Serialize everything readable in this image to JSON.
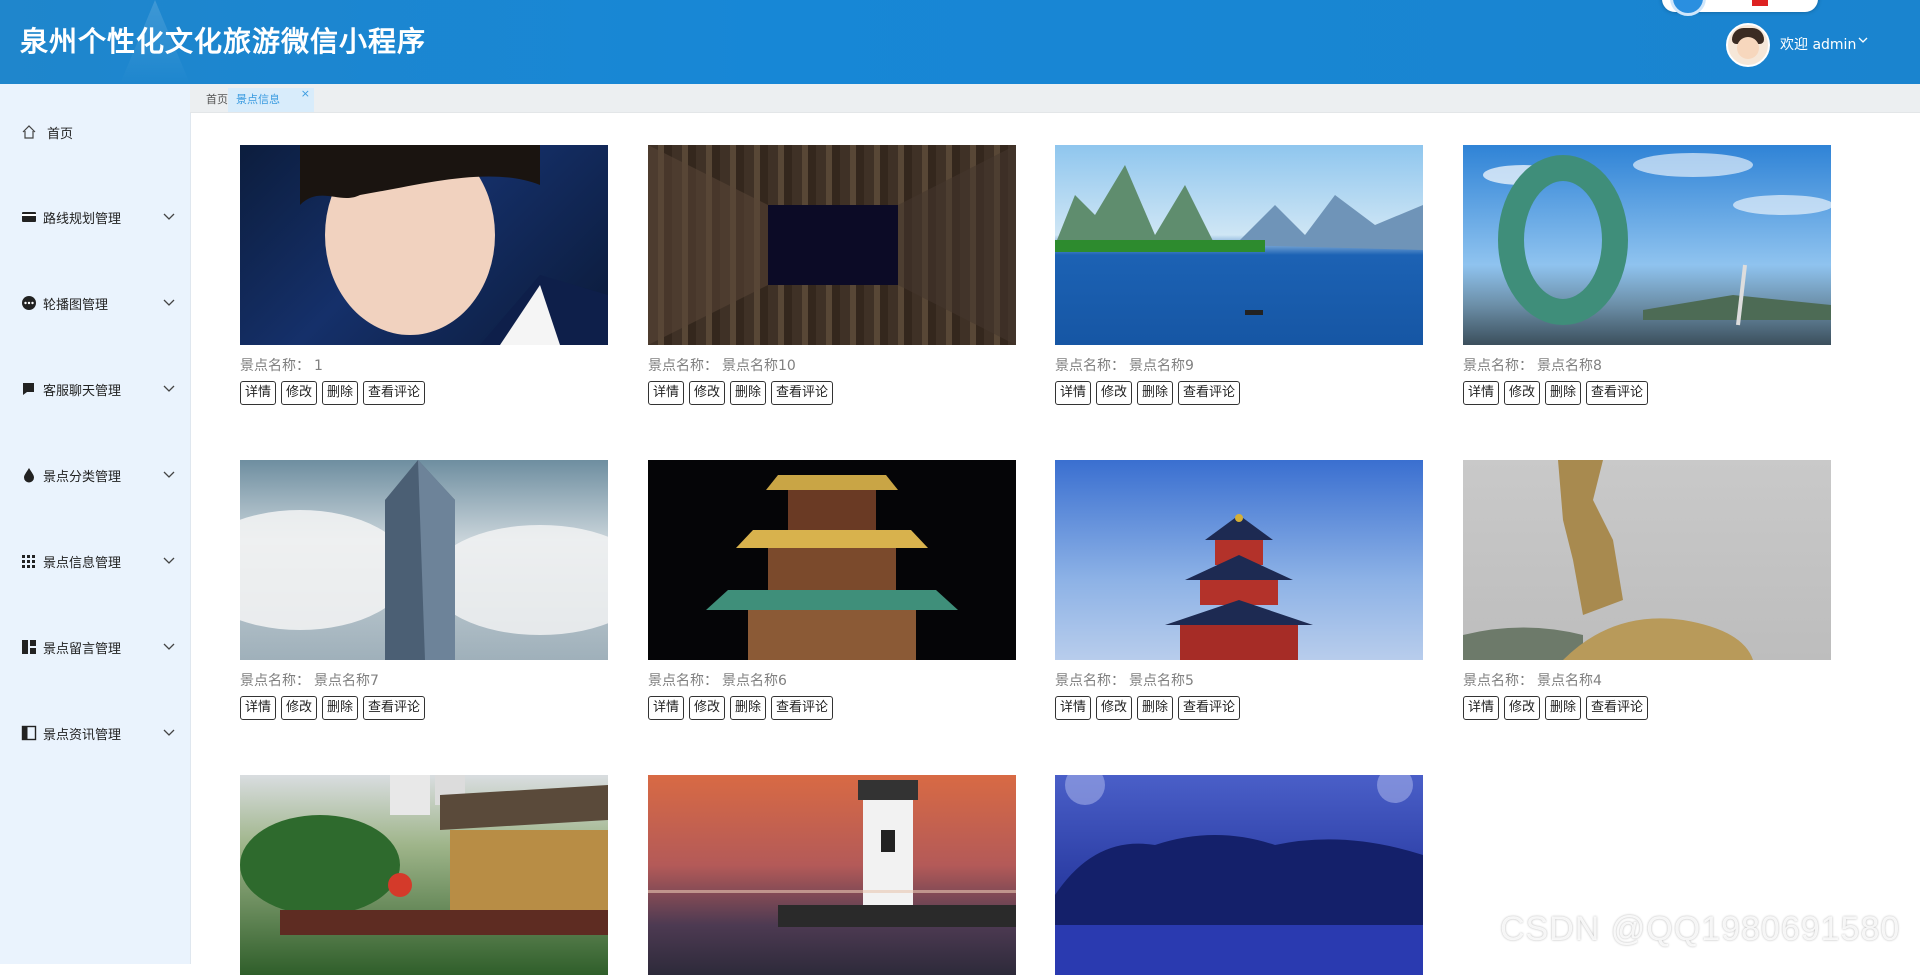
{
  "app": {
    "title": "泉州个性化文化旅游微信小程序"
  },
  "user": {
    "welcome": "欢迎 admin"
  },
  "tabs": [
    {
      "label": "首页"
    },
    {
      "label": "景点信息"
    }
  ],
  "sidebar": {
    "items": [
      {
        "label": "首页",
        "icon": "home-icon"
      },
      {
        "label": "路线规划管理",
        "icon": "card-icon"
      },
      {
        "label": "轮播图管理",
        "icon": "more-circle-icon"
      },
      {
        "label": "客服聊天管理",
        "icon": "chat-icon"
      },
      {
        "label": "景点分类管理",
        "icon": "drop-icon"
      },
      {
        "label": "景点信息管理",
        "icon": "grid-icon"
      },
      {
        "label": "景点留言管理",
        "icon": "layout-icon"
      },
      {
        "label": "景点资讯管理",
        "icon": "panel-icon"
      }
    ]
  },
  "card_prefix": "景点名称：",
  "buttons": {
    "detail": "详情",
    "edit": "修改",
    "delete": "删除",
    "comments": "查看评论"
  },
  "cards": [
    {
      "name": "1",
      "image": "portrait"
    },
    {
      "name": "景点名称10",
      "image": "buildings"
    },
    {
      "name": "景点名称9",
      "image": "karst-river"
    },
    {
      "name": "景点名称8",
      "image": "ring-sculpture"
    },
    {
      "name": "景点名称7",
      "image": "skyscraper-clouds"
    },
    {
      "name": "景点名称6",
      "image": "pagoda-night"
    },
    {
      "name": "景点名称5",
      "image": "temple-of-heaven"
    },
    {
      "name": "景点名称4",
      "image": "golden-statue"
    },
    {
      "name": "",
      "image": "garden-pavilion"
    },
    {
      "name": "",
      "image": "lighthouse-sunset"
    },
    {
      "name": "",
      "image": "blue-lake"
    }
  ],
  "watermark": "CSDN @QQ1980691580"
}
